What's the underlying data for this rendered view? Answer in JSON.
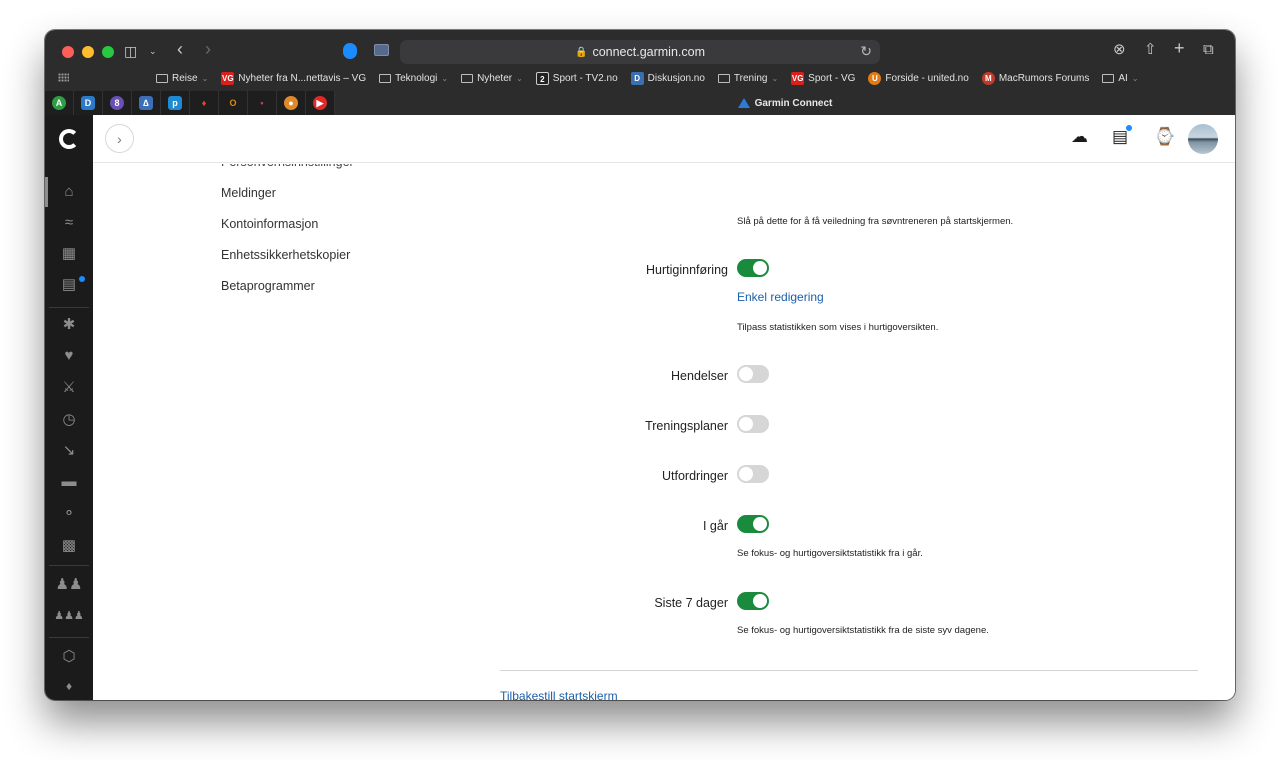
{
  "browser": {
    "url": "connect.garmin.com",
    "active_tab_title": "Garmin Connect",
    "bookmarks": [
      {
        "label": "Reise",
        "type": "folder"
      },
      {
        "label": "Nyheter fra N...nettavis – VG",
        "type": "site",
        "favicon_color": "#d7211d",
        "favicon_text": "VG"
      },
      {
        "label": "Teknologi",
        "type": "folder"
      },
      {
        "label": "Nyheter",
        "type": "folder"
      },
      {
        "label": "Sport - TV2.no",
        "type": "site",
        "favicon_color": "#222222",
        "favicon_text": "2"
      },
      {
        "label": "Diskusjon.no",
        "type": "site",
        "favicon_color": "#3a6fb0",
        "favicon_text": "D"
      },
      {
        "label": "Trening",
        "type": "folder"
      },
      {
        "label": "Sport - VG",
        "type": "site",
        "favicon_color": "#d7211d",
        "favicon_text": "VG"
      },
      {
        "label": "Forside - united.no",
        "type": "site",
        "favicon_color": "#e07b16",
        "favicon_text": "U"
      },
      {
        "label": "MacRumors Forums",
        "type": "site",
        "favicon_color": "#c23b2a",
        "favicon_text": "M"
      },
      {
        "label": "AI",
        "type": "folder"
      }
    ],
    "pinned_tabs": [
      {
        "name": "pinned-tab-1",
        "color": "#2e9d46",
        "glyph": "A"
      },
      {
        "name": "pinned-tab-2",
        "color": "#2a7ac8",
        "glyph": "D"
      },
      {
        "name": "pinned-tab-3",
        "color": "#6a4fb5",
        "glyph": "8"
      },
      {
        "name": "pinned-tab-4",
        "color": "#3d6fb8",
        "glyph": "∆"
      },
      {
        "name": "pinned-tab-5",
        "color": "#1f8ad2",
        "glyph": "p"
      },
      {
        "name": "pinned-tab-6",
        "color": "#e2462b",
        "glyph": "♦"
      },
      {
        "name": "pinned-tab-7",
        "color": "#e08a10",
        "glyph": "O"
      },
      {
        "name": "pinned-tab-8",
        "color": "#c23b6a",
        "glyph": "•"
      },
      {
        "name": "pinned-tab-9",
        "color": "#e0892b",
        "glyph": "●"
      },
      {
        "name": "pinned-tab-10",
        "color": "#e02a2a",
        "glyph": "▶"
      }
    ]
  },
  "settings_menu": {
    "items": [
      {
        "label": "Personvernsinnstillinger"
      },
      {
        "label": "Meldinger"
      },
      {
        "label": "Kontoinformasjon"
      },
      {
        "label": "Enhetssikkerhetskopier"
      },
      {
        "label": "Betaprogrammer"
      }
    ]
  },
  "settings": {
    "top_description": "Slå på dette for å få veiledning fra søvntreneren på startskjermen.",
    "rows": [
      {
        "label": "Hurtiginnføring",
        "enabled": true,
        "link": "Enkel redigering",
        "description": "Tilpass statistikken som vises i hurtigoversikten."
      },
      {
        "label": "Hendelser",
        "enabled": false
      },
      {
        "label": "Treningsplaner",
        "enabled": false
      },
      {
        "label": "Utfordringer",
        "enabled": false
      },
      {
        "label": "I går",
        "enabled": true,
        "description": "Se fokus- og hurtigoversiktstatistikk fra i går."
      },
      {
        "label": "Siste 7 dager",
        "enabled": true,
        "description": "Se fokus- og hurtigoversiktstatistikk fra de siste syv dagene."
      }
    ],
    "reset_link": "Tilbakestill startskjerm"
  },
  "colors": {
    "toggle_on": "#1a8a3c",
    "toggle_off": "#d6d6d6",
    "link": "#1b5fa8",
    "notification_dot": "#1a8cff"
  }
}
